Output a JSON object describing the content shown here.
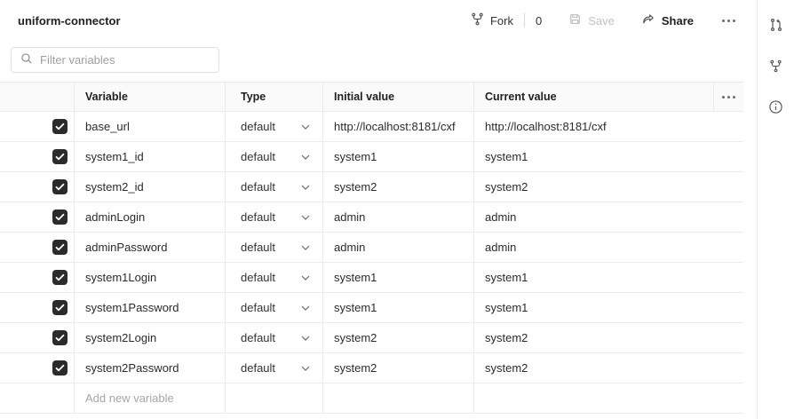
{
  "header": {
    "title": "uniform-connector",
    "toolbar": {
      "fork_label": "Fork",
      "fork_count": "0",
      "save_label": "Save",
      "share_label": "Share"
    }
  },
  "filter": {
    "placeholder": "Filter variables"
  },
  "table": {
    "columns": {
      "variable": "Variable",
      "type": "Type",
      "initial": "Initial value",
      "current": "Current value"
    },
    "rows": [
      {
        "checked": true,
        "variable": "base_url",
        "type": "default",
        "initial": "http://localhost:8181/cxf",
        "current": "http://localhost:8181/cxf"
      },
      {
        "checked": true,
        "variable": "system1_id",
        "type": "default",
        "initial": "system1",
        "current": "system1"
      },
      {
        "checked": true,
        "variable": "system2_id",
        "type": "default",
        "initial": "system2",
        "current": "system2"
      },
      {
        "checked": true,
        "variable": "adminLogin",
        "type": "default",
        "initial": "admin",
        "current": "admin"
      },
      {
        "checked": true,
        "variable": "adminPassword",
        "type": "default",
        "initial": "admin",
        "current": "admin"
      },
      {
        "checked": true,
        "variable": "system1Login",
        "type": "default",
        "initial": "system1",
        "current": "system1"
      },
      {
        "checked": true,
        "variable": "system1Password",
        "type": "default",
        "initial": "system1",
        "current": "system1"
      },
      {
        "checked": true,
        "variable": "system2Login",
        "type": "default",
        "initial": "system2",
        "current": "system2"
      },
      {
        "checked": true,
        "variable": "system2Password",
        "type": "default",
        "initial": "system2",
        "current": "system2"
      }
    ],
    "add_row_placeholder": "Add new variable"
  },
  "sidebar": {
    "icons": [
      "pull-request-icon",
      "fork-icon",
      "info-icon"
    ]
  },
  "colors": {
    "text": "#212121",
    "muted": "#6b6b6b",
    "disabled": "#c2c2c2",
    "border": "#ebebeb",
    "checkbox_bg": "#2b2b2b",
    "header_bg": "#fafafa"
  }
}
